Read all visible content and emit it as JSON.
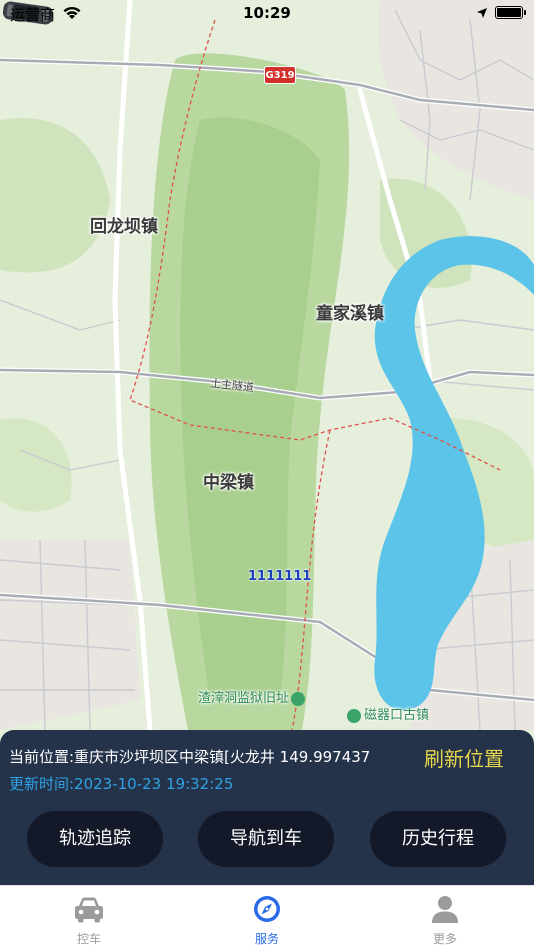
{
  "status_bar": {
    "carrier": "运营商",
    "time": "10:29"
  },
  "map": {
    "highway_shield": "G319",
    "labels": {
      "huilongba": "回龙坝镇",
      "tongjiaxi": "童家溪镇",
      "zhongliang": "中梁镇",
      "tunnel": "土主隧道",
      "zhazidong": "渣滓洞监狱旧址",
      "ciqikou": "磁器口古镇"
    },
    "car_plate": "1111111",
    "colors": {
      "river": "#5bc4e8",
      "forest": "#b9d8a0",
      "road": "#ffffff",
      "boundary": "#e0514a"
    }
  },
  "info_panel": {
    "current_location": "当前位置:重庆市沙坪坝区中梁镇[火龙井 149.997437",
    "update_time": "更新时间:2023-10-23 19:32:25",
    "refresh_label": "刷新位置",
    "buttons": {
      "track": "轨迹追踪",
      "navigate": "导航到车",
      "history": "历史行程"
    }
  },
  "tab_bar": {
    "items": [
      {
        "label": "控车",
        "icon": "car-icon",
        "active": false
      },
      {
        "label": "服务",
        "icon": "compass-icon",
        "active": true
      },
      {
        "label": "更多",
        "icon": "person-icon",
        "active": false
      }
    ],
    "active_color": "#2a6ae8",
    "inactive_color": "#9b9b9b"
  }
}
